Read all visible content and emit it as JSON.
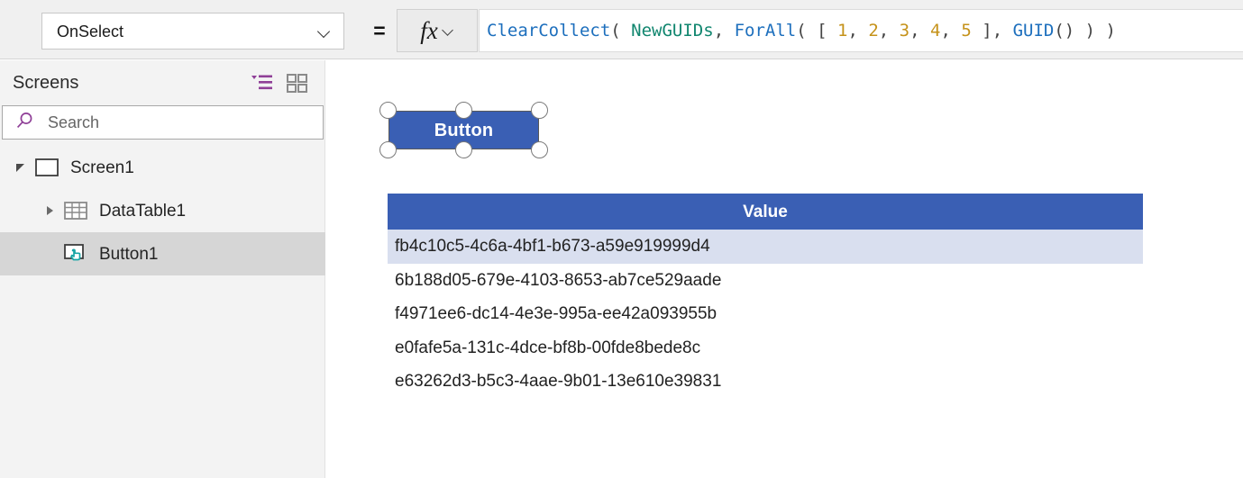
{
  "formula_bar": {
    "property_dropdown": {
      "value": "OnSelect",
      "icon": "chevron-down-icon"
    },
    "equals_sign": "=",
    "fx_button": {
      "glyph": "fx",
      "icon": "chevron-down-icon"
    },
    "formula_tokens": [
      {
        "text": "ClearCollect",
        "type": "fn"
      },
      {
        "text": "( ",
        "type": "punc"
      },
      {
        "text": "NewGUIDs",
        "type": "var"
      },
      {
        "text": ", ",
        "type": "punc"
      },
      {
        "text": "ForAll",
        "type": "fn"
      },
      {
        "text": "( [ ",
        "type": "punc"
      },
      {
        "text": "1",
        "type": "num"
      },
      {
        "text": ", ",
        "type": "punc"
      },
      {
        "text": "2",
        "type": "num"
      },
      {
        "text": ", ",
        "type": "punc"
      },
      {
        "text": "3",
        "type": "num"
      },
      {
        "text": ", ",
        "type": "punc"
      },
      {
        "text": "4",
        "type": "num"
      },
      {
        "text": ", ",
        "type": "punc"
      },
      {
        "text": "5",
        "type": "num"
      },
      {
        "text": " ], ",
        "type": "punc"
      },
      {
        "text": "GUID",
        "type": "fn"
      },
      {
        "text": "() ) )",
        "type": "punc"
      }
    ],
    "formula_text": "ClearCollect( NewGUIDs, ForAll( [ 1, 2, 3, 4, 5 ], GUID() ) )"
  },
  "sidebar": {
    "title": "Screens",
    "tree_view_icon": "tree-view-icon",
    "thumbnail_view_icon": "thumbnail-view-icon",
    "search": {
      "placeholder": "Search",
      "value": "",
      "icon": "search-icon"
    },
    "tree": [
      {
        "label": "Screen1",
        "level": 0,
        "twisty": "caret-down",
        "icon": "screen-icon",
        "selected": false
      },
      {
        "label": "DataTable1",
        "level": 1,
        "twisty": "caret-right",
        "icon": "datatable-icon",
        "selected": false
      },
      {
        "label": "Button1",
        "level": 1,
        "twisty": "none",
        "icon": "button-icon",
        "selected": true
      }
    ]
  },
  "canvas": {
    "button_widget": {
      "label": "Button",
      "selected": true,
      "fill_color": "#3a5fb4",
      "text_color": "#ffffff",
      "handles": [
        "top-left",
        "top-center",
        "top-right",
        "bottom-left",
        "bottom-center",
        "bottom-right"
      ]
    },
    "data_table": {
      "columns": [
        "Value"
      ],
      "header_color": "#3a5fb4",
      "selected_row_color": "#d9dfef",
      "selected_row_index": 0,
      "rows": [
        "fb4c10c5-4c6a-4bf1-b673-a59e919999d4",
        "6b188d05-679e-4103-8653-ab7ce529aade",
        "f4971ee6-dc14-4e3e-995a-ee42a093955b",
        "e0fafe5a-131c-4dce-bf8b-00fde8bede8c",
        "e63262d3-b5c3-4aae-9b01-13e610e39831"
      ]
    }
  },
  "colors": {
    "accent_blue": "#3a5fb4",
    "accent_purple": "#8f3f97",
    "accent_teal": "#17a5a5",
    "chrome_gray": "#f0f0f0"
  }
}
